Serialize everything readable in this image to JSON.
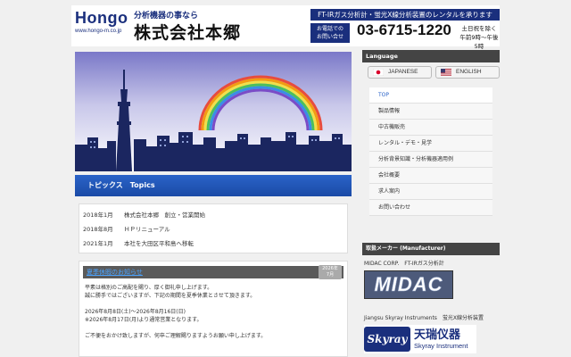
{
  "header": {
    "logo_word": "Hongo",
    "logo_url": "www.hongo-m.co.jp",
    "tagline": "分析機器の事なら",
    "company_name": "株式会社本郷",
    "rental_banner": "FT-IRガス分析計・蛍光X線分析装置のレンタルを承ります",
    "contact_line1": "お電話での",
    "contact_line2": "お問い合せ",
    "phone": "03-6715-1220",
    "hours_line1": "土日祝を除く",
    "hours_line2": "午前9時〜午後5時"
  },
  "topics": {
    "heading": "トピックス　Topics",
    "news": [
      {
        "date": "2018年1月",
        "text": "株式会社本郷　創立・営業開始"
      },
      {
        "date": "2018年8月",
        "text": "ＨＰリニューアル"
      },
      {
        "date": "2021年1月",
        "text": "本社を大田区平和島へ移転"
      }
    ]
  },
  "notice": {
    "title": "夏季休暇のお知らせ",
    "date_year": "2026年",
    "date_month": "7月",
    "body": [
      "平素は格別のご高配を賜り、厚く御礼申し上げます。",
      "誠に勝手ではございますが、下記の期間を夏季休業とさせて頂きます。",
      "",
      "2026年8月8日(土)〜2026年8月16日(日)",
      "※2026年8月17日(月)より通常営業となります。",
      "",
      "ご不便をおかけ致しますが、何卒ご理解賜りますようお願い申し上げます。"
    ]
  },
  "sidebar": {
    "language_title": "Language",
    "lang_japanese": "JAPANESE",
    "lang_english": "ENGLISH",
    "menu": [
      {
        "label": "TOP",
        "active": true
      },
      {
        "label": "製品情報",
        "active": false
      },
      {
        "label": "中古機販売",
        "active": false
      },
      {
        "label": "レンタル・デモ・見学",
        "active": false
      },
      {
        "label": "分析背景知識・分析機器適用例",
        "active": false
      },
      {
        "label": "会社概要",
        "active": false
      },
      {
        "label": "求人案内",
        "active": false
      },
      {
        "label": "お問い合わせ",
        "active": false
      }
    ],
    "manufacturer_title": "取扱メーカー (Manufacturer)",
    "mfr1_label": "MIDAC CORP.　FT-IRガス分析計",
    "mfr1_logo": "MIDAC",
    "mfr2_label": "Jiangsu Skyray Instruments　蛍光X線分析装置",
    "mfr2_logo_mark": "Skyray",
    "mfr2_logo_cn": "天瑞仪器",
    "mfr2_logo_en": "Skyray Instrument"
  },
  "colors": {
    "brand_navy": "#1a2f7d",
    "topics_blue": "#2a63c8",
    "sidebar_dark": "#444444"
  }
}
